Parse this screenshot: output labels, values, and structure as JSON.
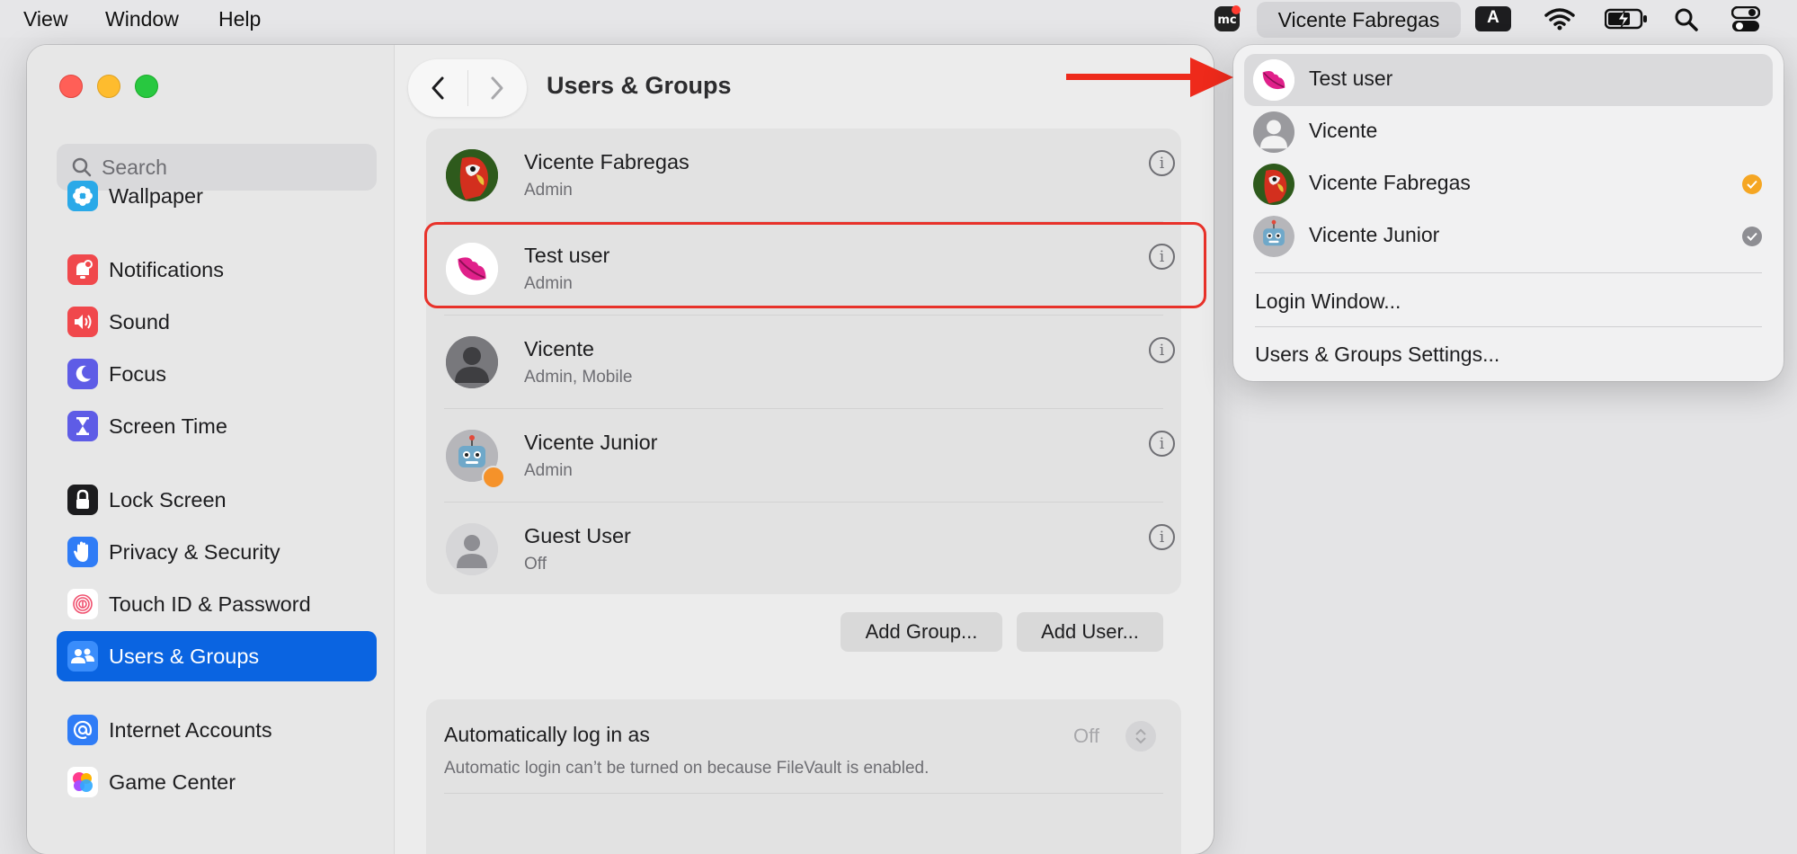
{
  "menubar": {
    "view": "View",
    "window": "Window",
    "help": "Help",
    "current_user": "Vicente Fabregas",
    "input_badge": "A",
    "icons": [
      "mc-app-icon",
      "wifi-icon",
      "battery-icon",
      "spotlight-search-icon",
      "control-center-icon"
    ]
  },
  "sidebar": {
    "search_placeholder": "Search",
    "items": [
      {
        "label": "Wallpaper",
        "icon": "wallpaper-icon"
      },
      {
        "label": "Notifications",
        "icon": "notifications-icon"
      },
      {
        "label": "Sound",
        "icon": "sound-icon"
      },
      {
        "label": "Focus",
        "icon": "focus-moon-icon"
      },
      {
        "label": "Screen Time",
        "icon": "hourglass-icon"
      },
      {
        "label": "Lock Screen",
        "icon": "lock-icon"
      },
      {
        "label": "Privacy & Security",
        "icon": "hand-icon"
      },
      {
        "label": "Touch ID & Password",
        "icon": "fingerprint-icon"
      },
      {
        "label": "Users & Groups",
        "icon": "users-icon",
        "selected": true
      },
      {
        "label": "Internet Accounts",
        "icon": "at-icon"
      },
      {
        "label": "Game Center",
        "icon": "game-center-icon"
      }
    ]
  },
  "main": {
    "title": "Users & Groups",
    "users": [
      {
        "name": "Vicente Fabregas",
        "role": "Admin",
        "avatar": "parrot-avatar"
      },
      {
        "name": "Test user",
        "role": "Admin",
        "avatar": "lips-avatar",
        "highlighted": true
      },
      {
        "name": "Vicente",
        "role": "Admin, Mobile",
        "avatar": "default-person-avatar"
      },
      {
        "name": "Vicente Junior",
        "role": "Admin",
        "avatar": "robot-avatar"
      },
      {
        "name": "Guest User",
        "role": "Off",
        "avatar": "guest-avatar"
      }
    ],
    "add_group": "Add Group...",
    "add_user": "Add User...",
    "auto_login": {
      "title": "Automatically log in as",
      "value": "Off",
      "description": "Automatic login can’t be turned on because FileVault is enabled."
    }
  },
  "dropdown": {
    "users": [
      {
        "name": "Test user",
        "avatar": "lips-avatar",
        "hover": true
      },
      {
        "name": "Vicente",
        "avatar": "default-person-avatar"
      },
      {
        "name": "Vicente Fabregas",
        "avatar": "parrot-avatar",
        "status": "current",
        "status_color": "#f5a623"
      },
      {
        "name": "Vicente Junior",
        "avatar": "robot-avatar",
        "status": "logged-in",
        "status_color": "#8e8e93"
      }
    ],
    "login_window": "Login Window...",
    "settings": "Users & Groups Settings..."
  },
  "colors": {
    "accent": "#0a64e1",
    "highlight_border": "#e8322a",
    "arrow": "#ee2a1b"
  }
}
